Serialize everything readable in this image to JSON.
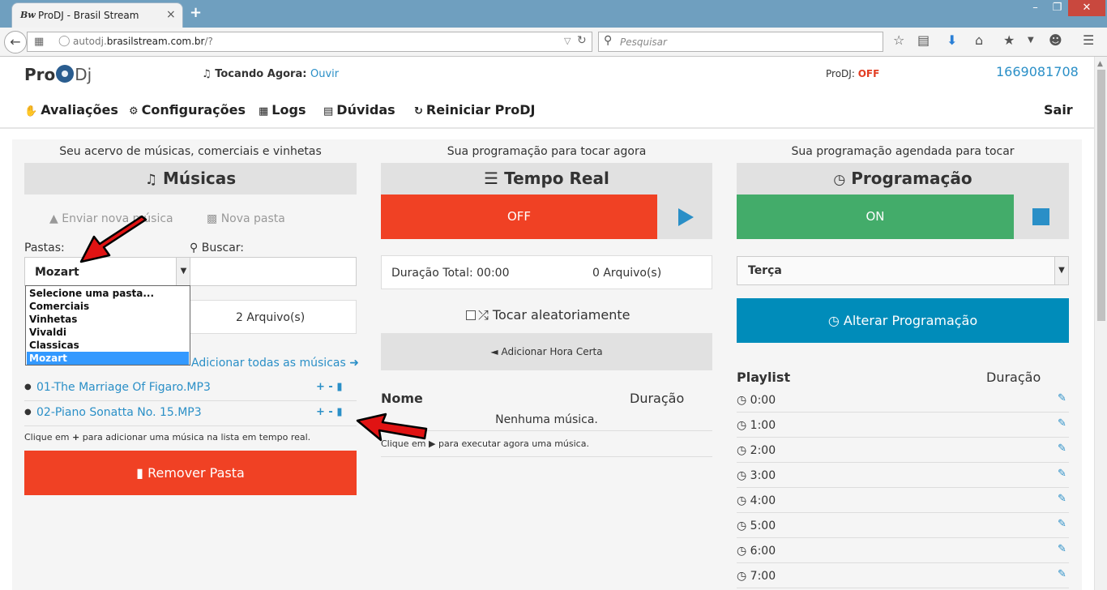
{
  "browser": {
    "tab_favicon": "Bw",
    "tab_title": "ProDJ - Brasil Stream",
    "tab_close": "×",
    "new_tab": "+",
    "url_prefix": "autodj.",
    "url_domain": "brasilstream.com.br",
    "url_suffix": "/?",
    "search_placeholder": "Pesquisar",
    "icons": [
      "back-icon",
      "grid-icon",
      "globe-icon",
      "reload-icon",
      "search-icon",
      "star-icon",
      "clipboard-icon",
      "download-icon",
      "home-icon",
      "extension-icon",
      "smiley-icon",
      "menu-icon"
    ]
  },
  "header": {
    "logo_pro": "Pro",
    "logo_dj": "Dj",
    "playing_label": "Tocando Agora:",
    "playing_link": "Ouvir",
    "prodj_label": "ProDJ:",
    "prodj_status": "OFF",
    "account_number": "1669081708"
  },
  "menu": {
    "avaliacoes": "Avaliações",
    "configuracoes": "Configurações",
    "logs": "Logs",
    "duvidas": "Dúvidas",
    "reiniciar": "Reiniciar ProDJ",
    "sair": "Sair"
  },
  "left": {
    "caption": "Seu acervo de músicas, comerciais e vinhetas",
    "title": "Músicas",
    "upload": "Enviar nova música",
    "new_folder": "Nova pasta",
    "folders_label": "Pastas:",
    "search_label": "Buscar:",
    "selected_folder": "Mozart",
    "folder_options": [
      "Selecione uma pasta...",
      "Comerciais",
      "Vinhetas",
      "Vivaldi",
      "Classicas",
      "Mozart"
    ],
    "files_count": "2 Arquivo(s)",
    "add_all": "Adicionar todas as músicas",
    "songs": [
      "01-The Marriage Of Figaro.MP3",
      "02-Piano Sonatta No. 15.MP3"
    ],
    "song_actions": "+ -",
    "hint_prefix": "Clique em",
    "hint_suffix": "para adicionar uma música na lista em tempo real.",
    "remove_folder": "Remover Pasta"
  },
  "middle": {
    "caption": "Sua programação para tocar agora",
    "title": "Tempo Real",
    "status": "OFF",
    "total_duration": "Duração Total: 00:00",
    "files_count": "0 Arquivo(s)",
    "shuffle": "Tocar aleatoriamente",
    "add_time": "Adicionar Hora Certa",
    "col_name": "Nome",
    "col_duration": "Duração",
    "empty": "Nenhuma música.",
    "exec_prefix": "Clique em",
    "exec_suffix": "para executar agora uma música."
  },
  "right": {
    "caption": "Sua programação agendada para tocar",
    "title": "Programação",
    "status": "ON",
    "day": "Terça",
    "alter_button": "Alterar Programação",
    "col_playlist": "Playlist",
    "col_duration": "Duração",
    "times": [
      "0:00",
      "1:00",
      "2:00",
      "3:00",
      "4:00",
      "5:00",
      "6:00",
      "7:00"
    ]
  },
  "colors": {
    "red": "#f04124",
    "green": "#43ac6a",
    "blue": "#008cba",
    "link": "#2a8fc7"
  }
}
